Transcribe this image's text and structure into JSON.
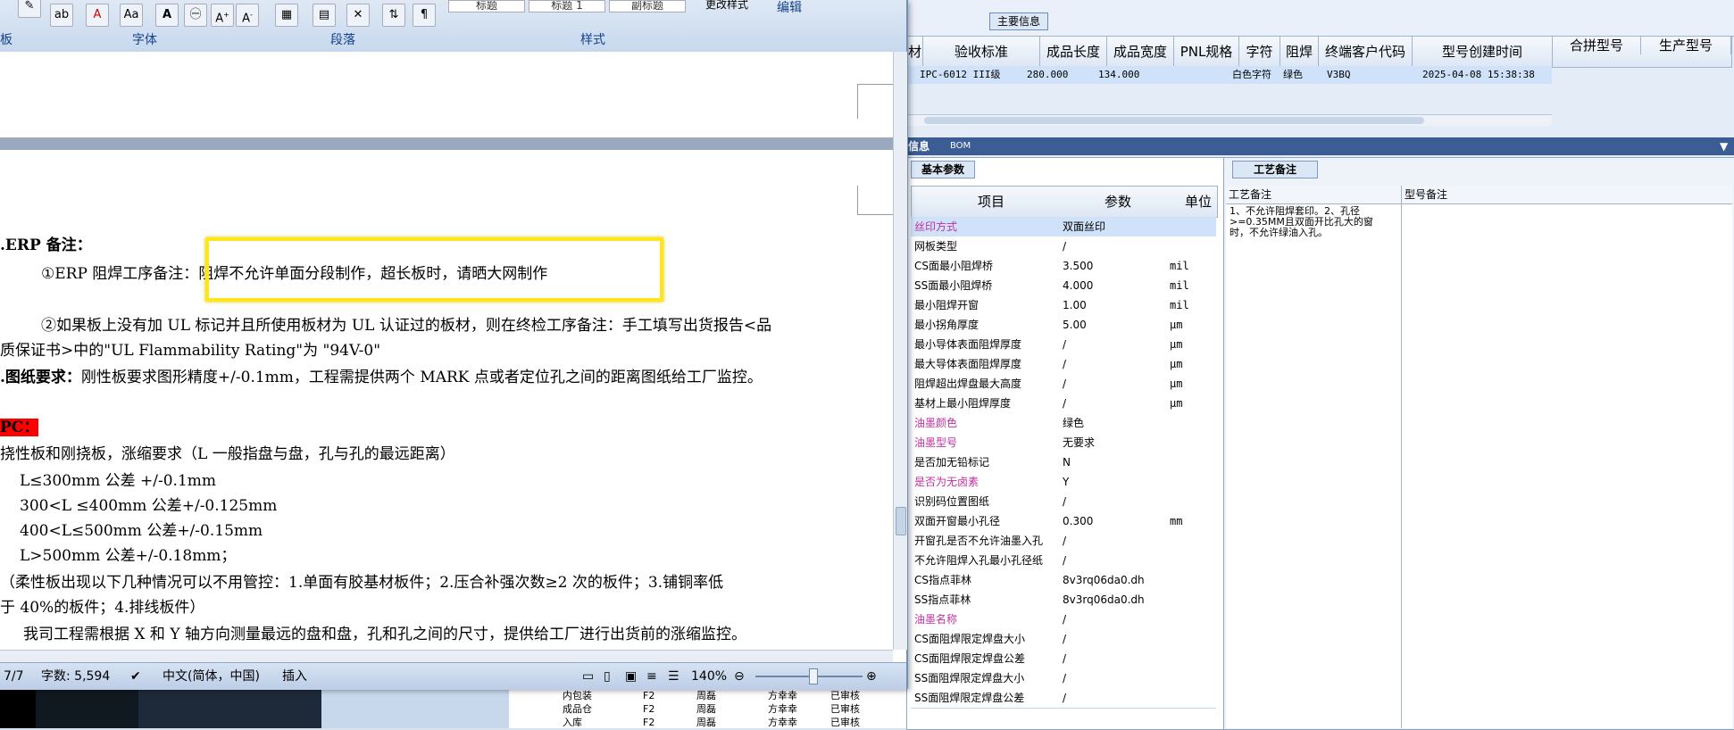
{
  "ribbon": {
    "groups": [
      "板",
      "字体",
      "段落",
      "样式",
      "编辑"
    ],
    "styles": [
      "标题",
      "标题 1",
      "副标题"
    ],
    "change_styles": "更改样式"
  },
  "document": {
    "lines": [
      {
        "prefix": ".ERP 备注：",
        "text": ""
      },
      {
        "prefix": "",
        "text": "①ERP 阻焊工序备注：阻焊不允许单面分段制作，超长板时，请晒大网制作"
      },
      {
        "prefix": "",
        "text": "②如果板上没有加 UL 标记并且所使用板材为 UL 认证过的板材，则在终检工序备注：手工填写出货报告<品"
      },
      {
        "prefix": "",
        "text": "质保证书>中的\"UL Flammability Rating\"为 \"94V-0\""
      },
      {
        "prefix": ".图纸要求：",
        "text": "刚性板要求图形精度+/-0.1mm，工程需提供两个 MARK 点或者定位孔之间的距离图纸给工厂监控。"
      },
      {
        "prefix": "PC：",
        "text": ""
      },
      {
        "prefix": "",
        "text": "挠性板和刚挠板，涨缩要求（L 一般指盘与盘，孔与孔的最远距离）"
      },
      {
        "prefix": "",
        "text": "L≤300mm 公差 +/-0.1mm"
      },
      {
        "prefix": "",
        "text": "300<L ≤400mm 公差+/-0.125mm"
      },
      {
        "prefix": "",
        "text": "400<L≤500mm 公差+/-0.15mm"
      },
      {
        "prefix": "",
        "text": "L>500mm 公差+/-0.18mm；"
      },
      {
        "prefix": "",
        "text": "（柔性板出现以下几种情况可以不用管控：1.单面有胶基材板件；2.压合补强次数≥2 次的板件；3.铺铜率低"
      },
      {
        "prefix": "",
        "text": "于 40%的板件；4.排线板件）"
      },
      {
        "prefix": "",
        "text": "我司工程需根据 X 和 Y 轴方向测量最远的盘和盘，孔和孔之间的尺寸，提供给工厂进行出货前的涨缩监控。"
      }
    ]
  },
  "status_bar": {
    "page": "7/7",
    "words": "字数: 5,594",
    "language": "中文(简体，中国)",
    "mode": "插入",
    "zoom": "140%"
  },
  "main_info": {
    "title": "主要信息",
    "columns": [
      "验收标准",
      "成品长度",
      "成品宽度",
      "PNL规格",
      "字符",
      "阻焊",
      "终端客户代码",
      "型号创建时间"
    ],
    "row": [
      "IPC-6012 III级",
      "280.000",
      "134.000",
      "",
      "白色字符",
      "绿色",
      "V3BQ",
      "2025-04-08 15:38:38"
    ],
    "right_columns": [
      "合拼型号",
      "生产型号"
    ]
  },
  "tabs": {
    "info": "信息",
    "bom": "BOM",
    "basic": "基本参数",
    "process": "工艺备注"
  },
  "params": {
    "headers": [
      "项目",
      "参数",
      "单位"
    ],
    "rows": [
      [
        "丝印方式",
        "双面丝印",
        ""
      ],
      [
        "网板类型",
        "/",
        ""
      ],
      [
        "CS面最小阻焊桥",
        "3.500",
        "mil"
      ],
      [
        "SS面最小阻焊桥",
        "4.000",
        "mil"
      ],
      [
        "最小阻焊开窗",
        "1.00",
        "mil"
      ],
      [
        "最小拐角厚度",
        "5.00",
        "μm"
      ],
      [
        "最小导体表面阻焊厚度",
        "/",
        "μm"
      ],
      [
        "最大导体表面阻焊厚度",
        "/",
        "μm"
      ],
      [
        "阻焊超出焊盘最大高度",
        "/",
        "μm"
      ],
      [
        "基材上最小阻焊厚度",
        "/",
        "μm"
      ],
      [
        "油墨颜色",
        "绿色",
        ""
      ],
      [
        "油墨型号",
        "无要求",
        ""
      ],
      [
        "是否加无铅标记",
        "N",
        ""
      ],
      [
        "是否为无卤素",
        "Y",
        ""
      ],
      [
        "识别码位置图纸",
        "/",
        ""
      ],
      [
        "双面开窗最小孔径",
        "0.300",
        "mm"
      ],
      [
        "开窗孔是否不允许油墨入孔",
        "/",
        ""
      ],
      [
        "不允许阻焊入孔最小孔径纸",
        "/",
        ""
      ],
      [
        "CS指点菲林",
        "8v3rq06da0.dh",
        ""
      ],
      [
        "SS指点菲林",
        "8v3rq06da0.dh",
        ""
      ],
      [
        "油墨名称",
        "/",
        ""
      ],
      [
        "CS面阻焊限定焊盘大小",
        "/",
        ""
      ],
      [
        "CS面阻焊限定焊盘公差",
        "/",
        ""
      ],
      [
        "SS面阻焊限定焊盘大小",
        "/",
        ""
      ],
      [
        "SS面阻焊限定焊盘公差",
        "/",
        ""
      ]
    ],
    "purple_rows": [
      0,
      10,
      11,
      13,
      20
    ]
  },
  "process_notes": {
    "col1": "工艺备注",
    "col2": "型号备注",
    "text": "1、不允许阻焊套印。2、孔径>=0.35MM且双面开比孔大的窗时，不允许绿油入孔。"
  },
  "tree": {
    "items": [
      {
        "name": "内包装",
        "a": "F2",
        "b": "周磊",
        "c": "方幸幸",
        "d": "已审核"
      },
      {
        "name": "成品仓",
        "a": "F2",
        "b": "周磊",
        "c": "方幸幸",
        "d": "已审核"
      },
      {
        "name": "入库",
        "a": "F2",
        "b": "周磊",
        "c": "方幸幸",
        "d": "已审核"
      }
    ]
  },
  "colors": {
    "accent": "#3b5d93",
    "purple": "#c030a0",
    "highlight_red": "#ff0000",
    "box_yellow": "#ffe51a"
  }
}
